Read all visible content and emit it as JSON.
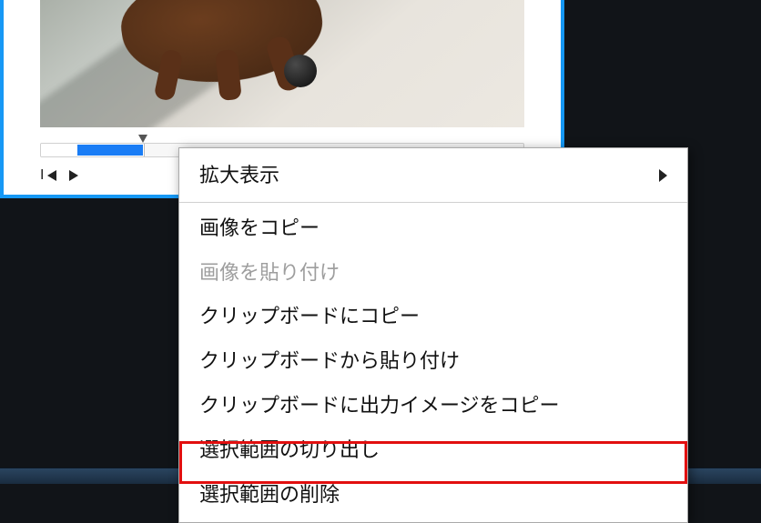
{
  "menu": {
    "zoom": "拡大表示",
    "copy_image": "画像をコピー",
    "paste_image": "画像を貼り付け",
    "clipboard_copy": "クリップボードにコピー",
    "clipboard_paste": "クリップボードから貼り付け",
    "clipboard_copy_output": "クリップボードに出力イメージをコピー",
    "cut_selection": "選択範囲の切り出し",
    "delete_selection": "選択範囲の削除"
  }
}
